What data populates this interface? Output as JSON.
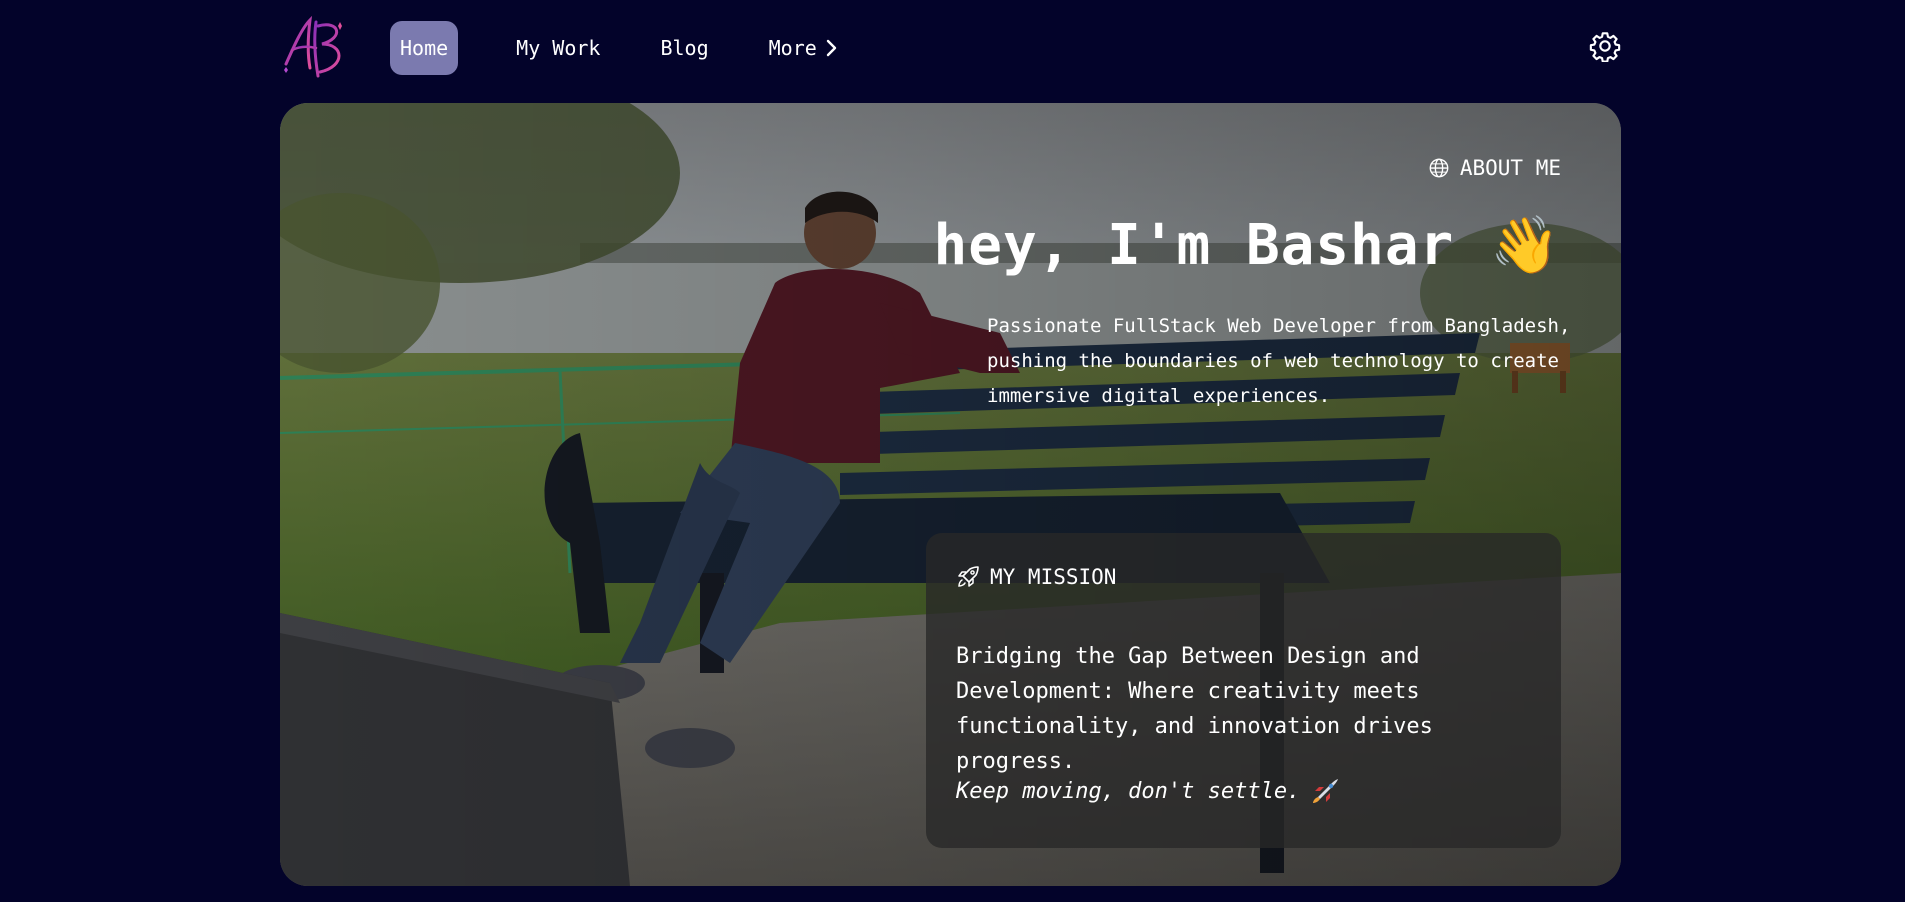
{
  "nav": {
    "logo_alt": "AB",
    "items": [
      {
        "label": "Home",
        "active": true
      },
      {
        "label": "My Work",
        "active": false
      },
      {
        "label": "Blog",
        "active": false
      },
      {
        "label": "More",
        "active": false,
        "has_chevron": true
      }
    ],
    "settings_icon": "gear-icon"
  },
  "hero": {
    "section_label": "ABOUT ME",
    "section_icon": "globe-icon",
    "title": "hey, I'm Bashar",
    "title_emoji": "👋",
    "description": "Passionate FullStack Web Developer from Bangladesh, pushing the boundaries of web technology to create immersive digital experiences."
  },
  "mission": {
    "heading": "MY MISSION",
    "heading_icon": "rocket-icon",
    "body": "Bridging the Gap Between Design and Development: Where creativity meets functionality, and innovation drives progress.",
    "quote": "Keep moving, don't settle."
  },
  "colors": {
    "page_background": "#03032a",
    "nav_active": "#7b7aaf",
    "card_background": "#282828",
    "logo_gradient_start": "#8b2fb8",
    "logo_gradient_end": "#e24e9a"
  }
}
